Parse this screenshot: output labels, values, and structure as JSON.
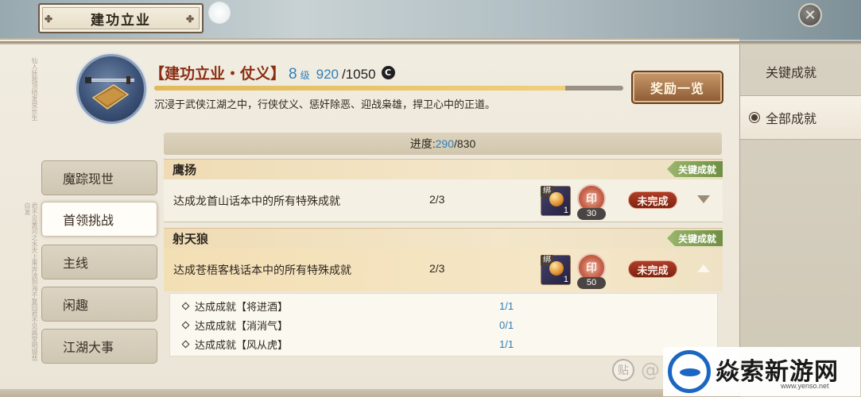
{
  "window": {
    "title": "建功立业",
    "close_icon": "close-icon"
  },
  "right_tabs": [
    {
      "label": "关键成就",
      "active": false
    },
    {
      "label": "全部成就",
      "active": true
    }
  ],
  "header": {
    "achievement_name": "【建功立业・仗义】",
    "level": "8",
    "level_unit": "级",
    "exp_current": "920",
    "exp_max": "/1050",
    "exp_fraction": 0.876,
    "currency_icon": "C",
    "description": "沉浸于武侠江湖之中，行侠仗义、惩奸除恶、迎战枭雄，捍卫心中的正道。",
    "reward_button": "奖励一览"
  },
  "left_tabs": [
    {
      "label": "魔踪现世",
      "active": false
    },
    {
      "label": "首领挑战",
      "active": true
    },
    {
      "label": "主线",
      "active": false
    },
    {
      "label": "闲趣",
      "active": false
    },
    {
      "label": "江湖大事",
      "active": false
    }
  ],
  "progress": {
    "label": "进度:",
    "current": "290",
    "total": "/830"
  },
  "groups": [
    {
      "title": "鹰扬",
      "tag": "关键成就",
      "row": {
        "description": "达成龙首山话本中的所有特殊成就",
        "count": "2/3",
        "item_bind": "绑",
        "item_qty": "1",
        "seal_glyph": "印",
        "seal_qty": "30",
        "status": "未完成",
        "expanded": false
      }
    },
    {
      "title": "射天狼",
      "tag": "关键成就",
      "row": {
        "description": "达成苍梧客栈话本中的所有特殊成就",
        "count": "2/3",
        "item_bind": "绑",
        "item_qty": "1",
        "seal_glyph": "印",
        "seal_qty": "50",
        "status": "未完成",
        "expanded": true
      },
      "sub_items": [
        {
          "label": "达成成就【将进酒】",
          "count": "1/1"
        },
        {
          "label": "达成成就【消消气】",
          "count": "0/1"
        },
        {
          "label": "达成成就【风从虎】",
          "count": "1/1"
        }
      ]
    }
  ],
  "watermark": {
    "brand": "焱索新游网",
    "url": "www.yenso.net",
    "tieba": "贴",
    "at": "@"
  }
}
